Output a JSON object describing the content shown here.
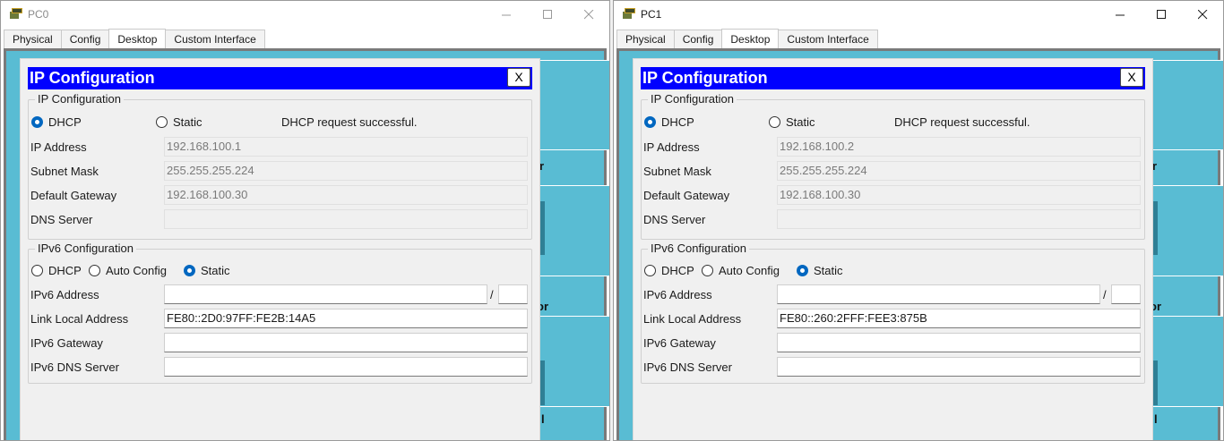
{
  "windows": [
    {
      "title": "PC0",
      "tabs": [
        "Physical",
        "Config",
        "Desktop",
        "Custom Interface"
      ],
      "active_tab": "Desktop",
      "dialog": {
        "title": "IP Configuration",
        "close_label": "X",
        "ipv4": {
          "group_label": "IP Configuration",
          "dhcp_label": "DHCP",
          "static_label": "Static",
          "selected": "DHCP",
          "status": "DHCP request successful.",
          "ip_label": "IP Address",
          "ip_value": "192.168.100.1",
          "mask_label": "Subnet Mask",
          "mask_value": "255.255.255.224",
          "gateway_label": "Default Gateway",
          "gateway_value": "192.168.100.30",
          "dns_label": "DNS Server",
          "dns_value": ""
        },
        "ipv6": {
          "group_label": "IPv6 Configuration",
          "dhcp_label": "DHCP",
          "auto_label": "Auto Config",
          "static_label": "Static",
          "selected": "Static",
          "address_label": "IPv6 Address",
          "address_value": "",
          "slash": "/",
          "prefix_value": "",
          "link_local_label": "Link Local Address",
          "link_local_value": "FE80::2D0:97FF:FE2B:14A5",
          "gateway_label": "IPv6 Gateway",
          "gateway_value": "",
          "dns_label": "IPv6 DNS Server",
          "dns_value": ""
        }
      },
      "background_text": {
        "partial_1": "r",
        "partial_2": "or",
        "partial_3": "l"
      }
    },
    {
      "title": "PC1",
      "tabs": [
        "Physical",
        "Config",
        "Desktop",
        "Custom Interface"
      ],
      "active_tab": "Desktop",
      "dialog": {
        "title": "IP Configuration",
        "close_label": "X",
        "ipv4": {
          "group_label": "IP Configuration",
          "dhcp_label": "DHCP",
          "static_label": "Static",
          "selected": "DHCP",
          "status": "DHCP request successful.",
          "ip_label": "IP Address",
          "ip_value": "192.168.100.2",
          "mask_label": "Subnet Mask",
          "mask_value": "255.255.255.224",
          "gateway_label": "Default Gateway",
          "gateway_value": "192.168.100.30",
          "dns_label": "DNS Server",
          "dns_value": ""
        },
        "ipv6": {
          "group_label": "IPv6 Configuration",
          "dhcp_label": "DHCP",
          "auto_label": "Auto Config",
          "static_label": "Static",
          "selected": "Static",
          "address_label": "IPv6 Address",
          "address_value": "",
          "slash": "/",
          "prefix_value": "",
          "link_local_label": "Link Local Address",
          "link_local_value": "FE80::260:2FFF:FEE3:875B",
          "gateway_label": "IPv6 Gateway",
          "gateway_value": "",
          "dns_label": "IPv6 DNS Server",
          "dns_value": ""
        }
      },
      "background_text": {
        "partial_1": "r",
        "partial_2": "or",
        "partial_3": "l"
      }
    }
  ],
  "colors": {
    "desktop_bg": "#59bcd3",
    "dialog_title_bg": "#0000ff",
    "radio_selected": "#0067c0"
  },
  "icons": {
    "app": "packet-tracer-pc-icon",
    "minimize": "minimize-icon",
    "maximize": "maximize-icon",
    "close": "close-icon"
  }
}
